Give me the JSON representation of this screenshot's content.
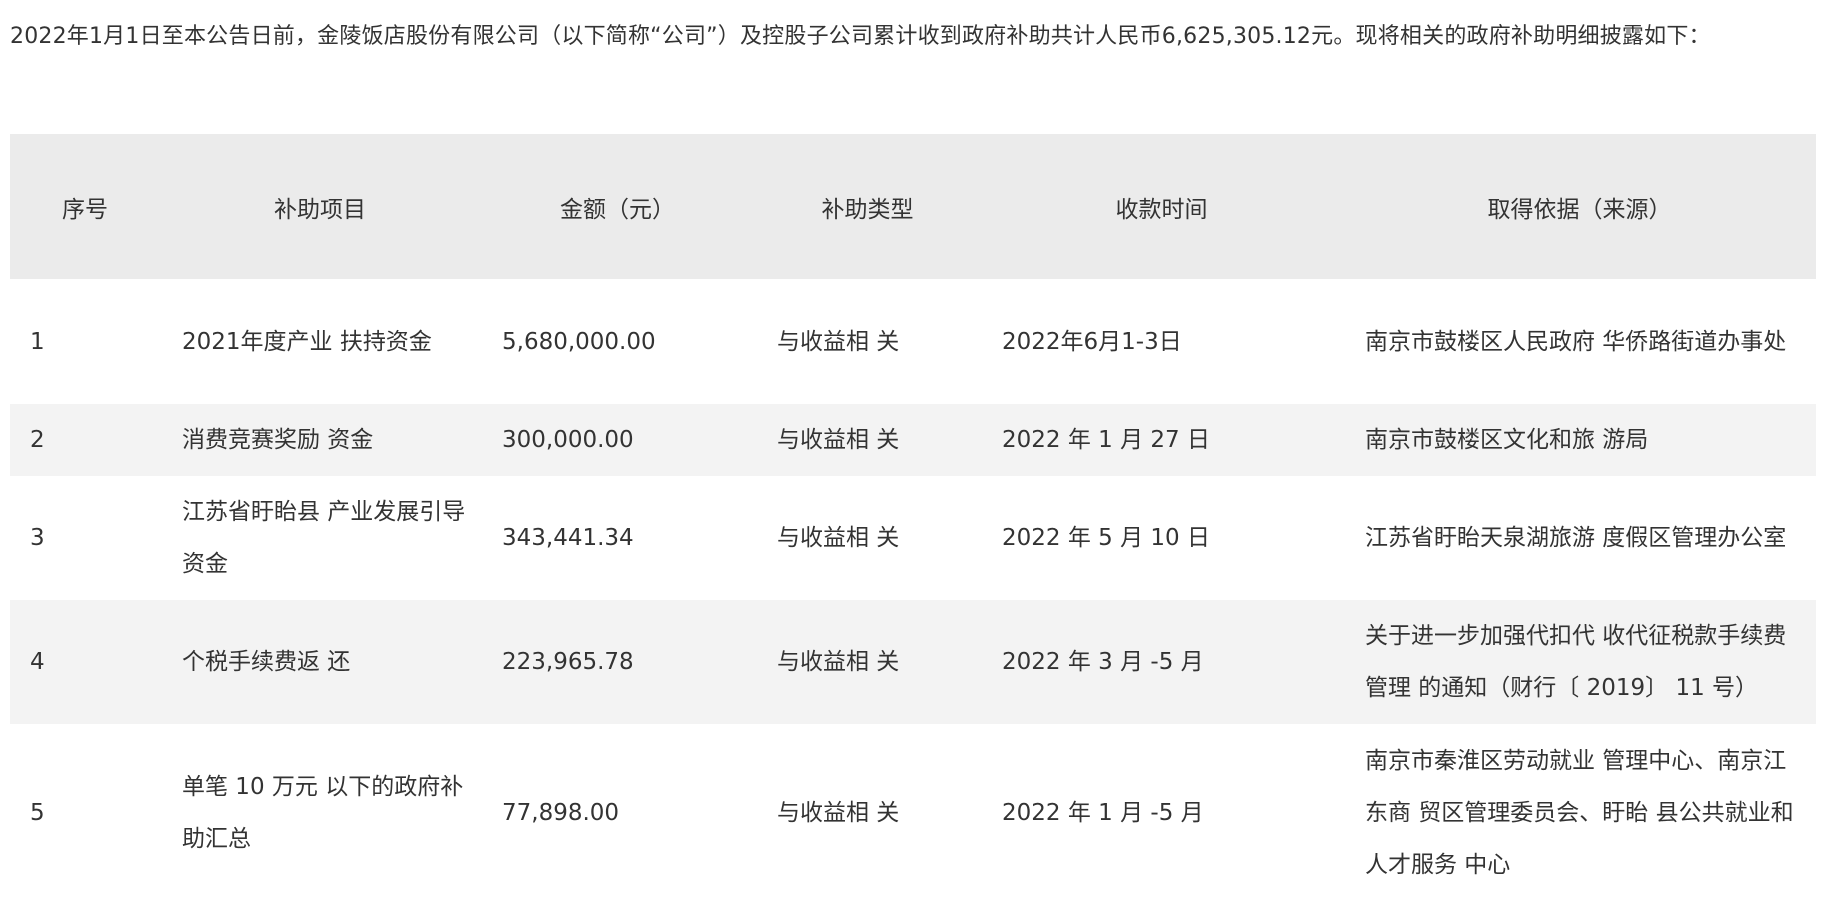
{
  "intro": "2022年1月1日至本公告日前，金陵饭店股份有限公司（以下简称“公司”）及控股子公司累计收到政府补助共计人民币6,625,305.12元。现将相关的政府补助明细披露如下：",
  "table": {
    "headers": [
      "序号",
      "补助项目",
      "金额（元）",
      "补助类型",
      "收款时间",
      "取得依据（来源）"
    ],
    "rows": [
      {
        "no": "1",
        "item": "2021年度产业 扶持资金",
        "amount": "5,680,000.00",
        "type": "与收益相 关",
        "date": "2022年6月1-3日",
        "source": "南京市鼓楼区人民政府 华侨路街道办事处"
      },
      {
        "no": "2",
        "item": "消费竞赛奖励 资金",
        "amount": "300,000.00",
        "type": "与收益相 关",
        "date": "2022 年 1 月 27 日",
        "source": "南京市鼓楼区文化和旅 游局"
      },
      {
        "no": "3",
        "item": "江苏省盱眙县 产业发展引导 资金",
        "amount": "343,441.34",
        "type": "与收益相 关",
        "date": "2022 年 5 月 10 日",
        "source": "江苏省盱眙天泉湖旅游 度假区管理办公室"
      },
      {
        "no": "4",
        "item": "个税手续费返 还",
        "amount": "223,965.78",
        "type": "与收益相 关",
        "date": "2022 年 3 月 -5 月",
        "source": "关于进一步加强代扣代 收代征税款手续费管理 的通知（财行〔 2019〕 11 号）"
      },
      {
        "no": "5",
        "item": "单笔 10 万元 以下的政府补 助汇总",
        "amount": "77,898.00",
        "type": "与收益相 关",
        "date": "2022 年 1 月 -5 月",
        "source": "南京市秦淮区劳动就业 管理中心、南京江东商 贸区管理委员会、盱眙 县公共就业和人才服务 中心"
      }
    ]
  }
}
